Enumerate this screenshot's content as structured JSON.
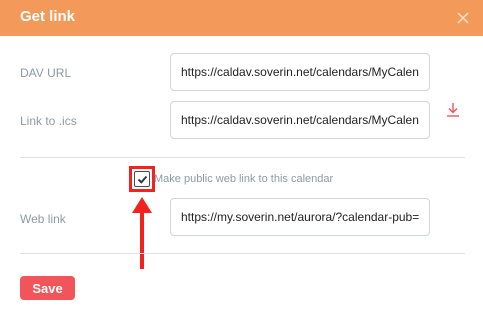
{
  "dialog": {
    "title": "Get link",
    "colors": {
      "header": "#f39a5b",
      "save_button": "#f2545b",
      "highlight": "#f2231f"
    }
  },
  "fields": {
    "dav_url": {
      "label": "DAV URL",
      "value": "https://caldav.soverin.net/calendars/MyCalendar"
    },
    "ics_link": {
      "label": "Link to .ics",
      "value": "https://caldav.soverin.net/calendars/MyCalendar.ics"
    },
    "web_link": {
      "label": "Web link",
      "value": "https://my.soverin.net/aurora/?calendar-pub=..."
    }
  },
  "public_checkbox": {
    "label": "Make public web link to this calendar",
    "checked": true
  },
  "buttons": {
    "save_label": "Save"
  },
  "icons": {
    "close": "close-icon",
    "download": "download-icon",
    "check": "check-icon",
    "annotation_arrow": "arrow-up-icon"
  }
}
